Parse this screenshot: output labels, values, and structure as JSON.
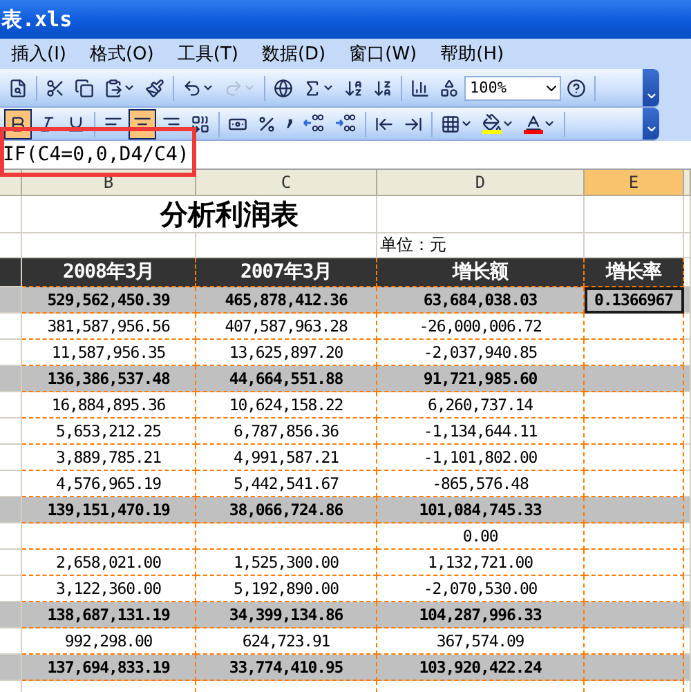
{
  "window": {
    "title": "表.xls"
  },
  "menu": [
    {
      "label": "插入(I)"
    },
    {
      "label": "格式(O)"
    },
    {
      "label": "工具(T)"
    },
    {
      "label": "数据(D)"
    },
    {
      "label": "窗口(W)"
    },
    {
      "label": "帮助(H)"
    }
  ],
  "toolbar_standard": [
    [
      {
        "kind": "research",
        "selected": false,
        "disabled": false,
        "dropdown": false
      }
    ],
    [
      {
        "kind": "cut",
        "selected": false,
        "disabled": false,
        "dropdown": false
      },
      {
        "kind": "copy",
        "selected": false,
        "disabled": false,
        "dropdown": false
      },
      {
        "kind": "paste",
        "selected": false,
        "disabled": false,
        "dropdown": true
      },
      {
        "kind": "format-painter",
        "selected": false,
        "disabled": false,
        "dropdown": false
      }
    ],
    [
      {
        "kind": "undo",
        "selected": false,
        "disabled": false,
        "dropdown": true
      },
      {
        "kind": "redo",
        "selected": false,
        "disabled": true,
        "dropdown": true
      }
    ],
    [
      {
        "kind": "hyperlink",
        "selected": false,
        "disabled": false,
        "dropdown": false
      },
      {
        "kind": "autosum",
        "selected": false,
        "disabled": false,
        "dropdown": true
      },
      {
        "kind": "sort-ascending",
        "selected": false,
        "disabled": false,
        "dropdown": false
      },
      {
        "kind": "sort-descending",
        "selected": false,
        "disabled": false,
        "dropdown": false
      }
    ],
    [
      {
        "kind": "chart",
        "selected": false,
        "disabled": false,
        "dropdown": false
      },
      {
        "kind": "drawing",
        "selected": false,
        "disabled": false,
        "dropdown": false
      },
      {
        "kind": "zoom",
        "value": "100%"
      },
      {
        "kind": "help",
        "selected": false,
        "disabled": false,
        "dropdown": false
      }
    ]
  ],
  "toolbar_formatting": [
    [
      {
        "kind": "bold",
        "selected": true,
        "disabled": false,
        "dropdown": false
      },
      {
        "kind": "italic",
        "selected": false,
        "disabled": false,
        "dropdown": false
      },
      {
        "kind": "underline",
        "selected": false,
        "disabled": false,
        "dropdown": false
      }
    ],
    [
      {
        "kind": "align-left",
        "selected": false,
        "disabled": false,
        "dropdown": false
      },
      {
        "kind": "align-center",
        "selected": true,
        "disabled": false,
        "dropdown": false
      },
      {
        "kind": "align-right",
        "selected": false,
        "disabled": false,
        "dropdown": false
      },
      {
        "kind": "merge",
        "selected": false,
        "disabled": false,
        "dropdown": false
      }
    ],
    [
      {
        "kind": "currency",
        "selected": false,
        "disabled": false,
        "dropdown": false
      },
      {
        "kind": "percent",
        "selected": false,
        "disabled": false,
        "dropdown": false
      },
      {
        "kind": "comma",
        "selected": false,
        "disabled": false,
        "dropdown": false
      },
      {
        "kind": "increase-decimal",
        "selected": false,
        "disabled": false,
        "dropdown": false
      },
      {
        "kind": "decrease-decimal",
        "selected": false,
        "disabled": false,
        "dropdown": false
      }
    ],
    [
      {
        "kind": "outdent",
        "selected": false,
        "disabled": false,
        "dropdown": false
      },
      {
        "kind": "indent",
        "selected": false,
        "disabled": false,
        "dropdown": false
      }
    ],
    [
      {
        "kind": "borders",
        "selected": false,
        "disabled": false,
        "dropdown": true
      },
      {
        "kind": "fill-color",
        "selected": false,
        "disabled": false,
        "dropdown": true,
        "color": "#ffff00"
      },
      {
        "kind": "font-color",
        "selected": false,
        "disabled": false,
        "dropdown": true,
        "color": "#ff0000"
      }
    ]
  ],
  "formula_bar": {
    "formula": "IF(C4=0,0,D4/C4)",
    "highlighted": true
  },
  "columns": [
    {
      "label": "B",
      "selected": false
    },
    {
      "label": "C",
      "selected": false
    },
    {
      "label": "D",
      "selected": false
    },
    {
      "label": "E",
      "selected": true
    }
  ],
  "sheet": {
    "title": "分析利润表",
    "unit": "单位：元",
    "headers": [
      "2008年3月",
      "2007年3月",
      "增长额",
      "增长率"
    ],
    "rows": [
      {
        "kind": "total",
        "b": "529,562,450.39",
        "c": "465,878,412.36",
        "d": "63,684,038.03",
        "e": "0.1366967",
        "selected": true
      },
      {
        "kind": "item",
        "b": "381,587,956.56",
        "c": "407,587,963.28",
        "d": "-26,000,006.72",
        "selected": false
      },
      {
        "kind": "item",
        "b": "11,587,956.35",
        "c": "13,625,897.20",
        "d": "-2,037,940.85",
        "selected": false
      },
      {
        "kind": "total",
        "b": "136,386,537.48",
        "c": "44,664,551.88",
        "d": "91,721,985.60",
        "selected": false
      },
      {
        "kind": "item",
        "b": "16,884,895.36",
        "c": "10,624,158.22",
        "d": "6,260,737.14",
        "selected": false
      },
      {
        "kind": "item",
        "b": "5,653,212.25",
        "c": "6,787,856.36",
        "d": "-1,134,644.11",
        "selected": false
      },
      {
        "kind": "item",
        "b": "3,889,785.21",
        "c": "4,991,587.21",
        "d": "-1,101,802.00",
        "selected": false
      },
      {
        "kind": "item",
        "b": "4,576,965.19",
        "c": "5,442,541.67",
        "d": "-865,576.48",
        "selected": false
      },
      {
        "kind": "total",
        "b": "139,151,470.19",
        "c": "38,066,724.86",
        "d": "101,084,745.33",
        "selected": false
      },
      {
        "kind": "item",
        "d": "0.00",
        "selected": false
      },
      {
        "kind": "item",
        "b": "2,658,021.00",
        "c": "1,525,300.00",
        "d": "1,132,721.00",
        "selected": false
      },
      {
        "kind": "item",
        "b": "3,122,360.00",
        "c": "5,192,890.00",
        "d": "-2,070,530.00",
        "selected": false
      },
      {
        "kind": "total",
        "b": "138,687,131.19",
        "c": "34,399,134.86",
        "d": "104,287,996.33",
        "selected": false
      },
      {
        "kind": "item",
        "b": "992,298.00",
        "c": "624,723.91",
        "d": "367,574.09",
        "selected": false
      },
      {
        "kind": "total",
        "b": "137,694,833.19",
        "c": "33,774,410.95",
        "d": "103,920,422.24",
        "selected": false
      },
      {
        "kind": "item",
        "selected": false
      }
    ]
  }
}
